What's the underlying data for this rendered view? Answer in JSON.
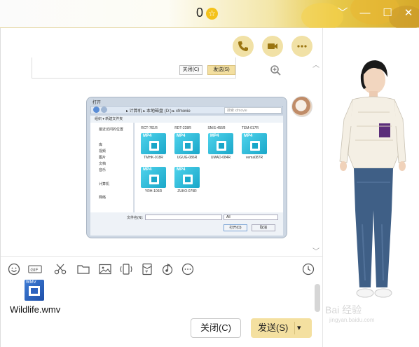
{
  "titlebar": {
    "count": "0",
    "star": "☆"
  },
  "window_buttons": [
    "﹀",
    "—",
    "☐",
    "✕"
  ],
  "preview_box": {
    "close_label": "关闭(C)",
    "send_label": "发送(S)"
  },
  "screenshot": {
    "caption": "打开",
    "address": "▸ 计算机 ▸ 本地磁盘 (D:) ▸ xfmovie",
    "search_placeholder": "搜索 xfmovie",
    "toolbar": "组织 ▾   新建文件夹",
    "nav": [
      "最近访问的位置",
      "库",
      "视频",
      "图片",
      "文档",
      "音乐",
      "计算机",
      "网络"
    ],
    "top_row": [
      "RCT-761R",
      "RDT-228R",
      "SNIS-455R",
      "TEM-017R"
    ],
    "tiles": [
      {
        "tag": "MP4",
        "label": "TMHK-018R"
      },
      {
        "tag": "MP4",
        "label": "UGUG-086R"
      },
      {
        "tag": "MP4",
        "label": "UMAD-084R"
      },
      {
        "tag": "MP4",
        "label": "vema087R"
      },
      {
        "tag": "MP4",
        "label": "YRH-106R"
      },
      {
        "tag": "MP4",
        "label": "ZUKO-079R"
      }
    ],
    "filename_label": "文件名(N):",
    "type_value": "All",
    "open_label": "打开(O)",
    "cancel_label": "取消"
  },
  "tools": [
    "emoji-icon",
    "gif-icon",
    "scissors-icon",
    "folder-icon",
    "image-icon",
    "shake-icon",
    "wallet-icon",
    "music-icon",
    "more-icon",
    "history-icon"
  ],
  "gif_label": "GIF",
  "attachment": {
    "tag": "WMV",
    "name": "Wildlife.wmv"
  },
  "buttons": {
    "close": "关闭(C)",
    "send": "发送(S)",
    "dropdown": "▾"
  },
  "watermark": {
    "main": "Bai 经验",
    "sub": "jingyan.baidu.com"
  }
}
